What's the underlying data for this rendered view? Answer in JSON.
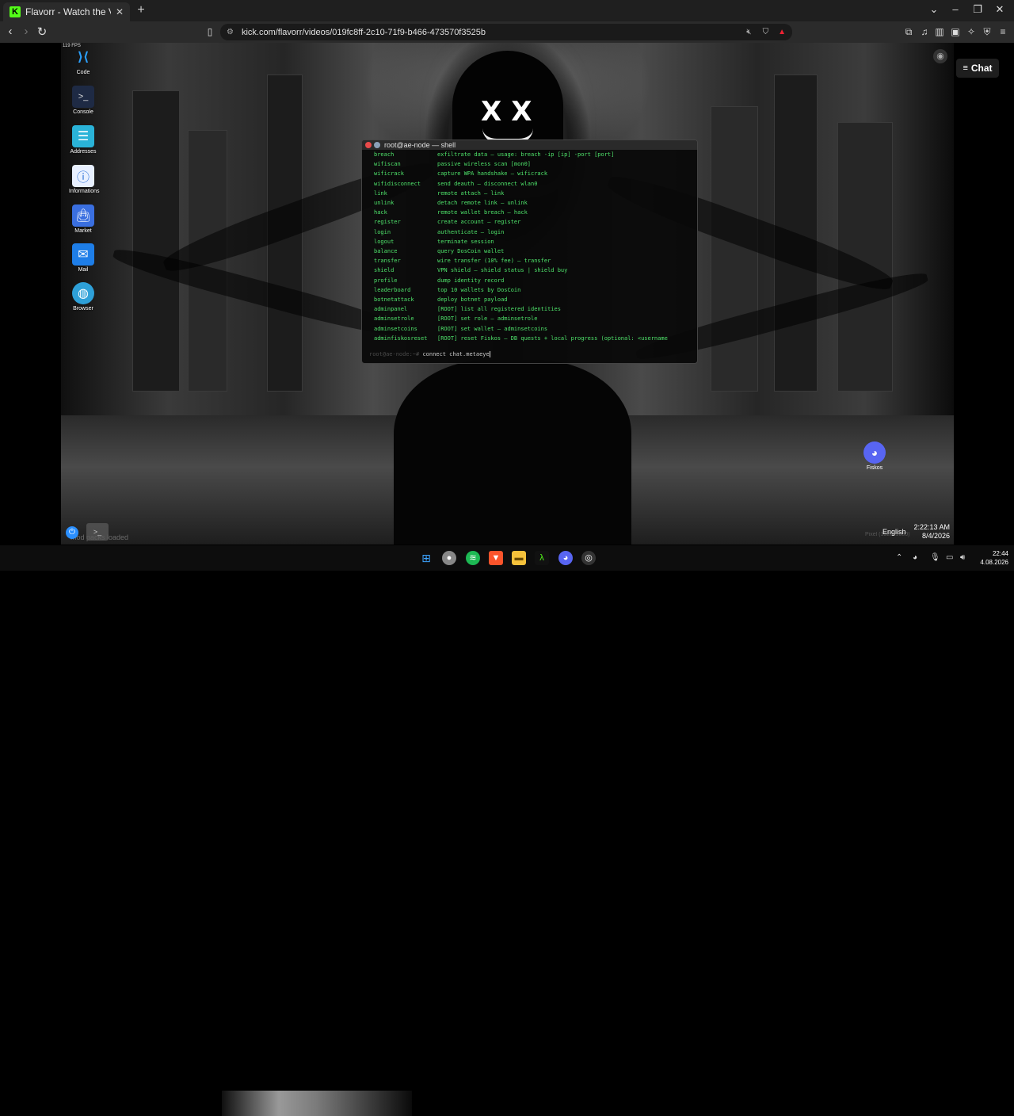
{
  "browser": {
    "tab_title": "Flavorr - Watch the VOD on K",
    "tab_favicon": "K",
    "url": "kick.com/flavorr/videos/019fc8ff-2c10-71f9-b466-473570f3525b"
  },
  "video": {
    "fps": "119 FPS",
    "desktop_icons": [
      {
        "label": "Code",
        "icon": "vscode-icon"
      },
      {
        "label": "Console",
        "icon": "console-icon"
      },
      {
        "label": "Addresses",
        "icon": "address-book-icon"
      },
      {
        "label": "Informations",
        "icon": "info-icon"
      },
      {
        "label": "Market",
        "icon": "market-bag-icon"
      },
      {
        "label": "Mail",
        "icon": "mail-icon"
      },
      {
        "label": "Browser",
        "icon": "globe-icon"
      }
    ],
    "terminal": {
      "title": "root@ae-node — shell",
      "rows": [
        {
          "cmd": "breach",
          "desc": "exfiltrate data — usage: breach -ip [ip] -port [port]"
        },
        {
          "cmd": "wifiscan",
          "desc": "passive wireless scan [mon0]"
        },
        {
          "cmd": "wificrack",
          "desc": "capture WPA handshake — wificrack"
        },
        {
          "cmd": "wifidisconnect",
          "desc": "send deauth — disconnect wlan0"
        },
        {
          "cmd": "link",
          "desc": "remote attach — link"
        },
        {
          "cmd": "unlink",
          "desc": "detach remote link — unlink"
        },
        {
          "cmd": "hack",
          "desc": "remote wallet breach — hack"
        },
        {
          "cmd": "register",
          "desc": "create account — register"
        },
        {
          "cmd": "login",
          "desc": "authenticate — login"
        },
        {
          "cmd": "logout",
          "desc": "terminate session"
        },
        {
          "cmd": "balance",
          "desc": "query DosCoin wallet"
        },
        {
          "cmd": "transfer",
          "desc": "wire transfer (10% fee) — transfer"
        },
        {
          "cmd": "shield",
          "desc": "VPN shield — shield status | shield buy"
        },
        {
          "cmd": "profile",
          "desc": "dump identity record"
        },
        {
          "cmd": "leaderboard",
          "desc": "top 10 wallets by DosCoin"
        },
        {
          "cmd": "botnetattack",
          "desc": "deploy botnet payload"
        },
        {
          "cmd": "adminpanel",
          "desc": "[ROOT] list all registered identities"
        },
        {
          "cmd": "adminsetrole",
          "desc": "[ROOT] set role — adminsetrole"
        },
        {
          "cmd": "adminsetcoins",
          "desc": "[ROOT] set wallet — adminsetcoins"
        },
        {
          "cmd": "adminfiskosreset",
          "desc": "[ROOT] reset Fiskos — DB quests + local progress (optional: <username"
        }
      ],
      "prompt_host": "root@ae-node:~#",
      "prompt_input": "connect chat.metaeye"
    },
    "taskbar": {
      "status": "mod packs loaded",
      "language": "English",
      "time": "2:22:13 AM",
      "date": "8/4/2026",
      "pixel_label": "Pixel (1920x1080)"
    },
    "fiskos_label": "Fiskos"
  },
  "chat_button": "Chat",
  "windows_taskbar": {
    "time": "22:44",
    "date": "4.08.2026"
  },
  "colors": {
    "terminal_text": "#4ee26a",
    "kick_green": "#53fc18",
    "discord": "#5865f2"
  }
}
